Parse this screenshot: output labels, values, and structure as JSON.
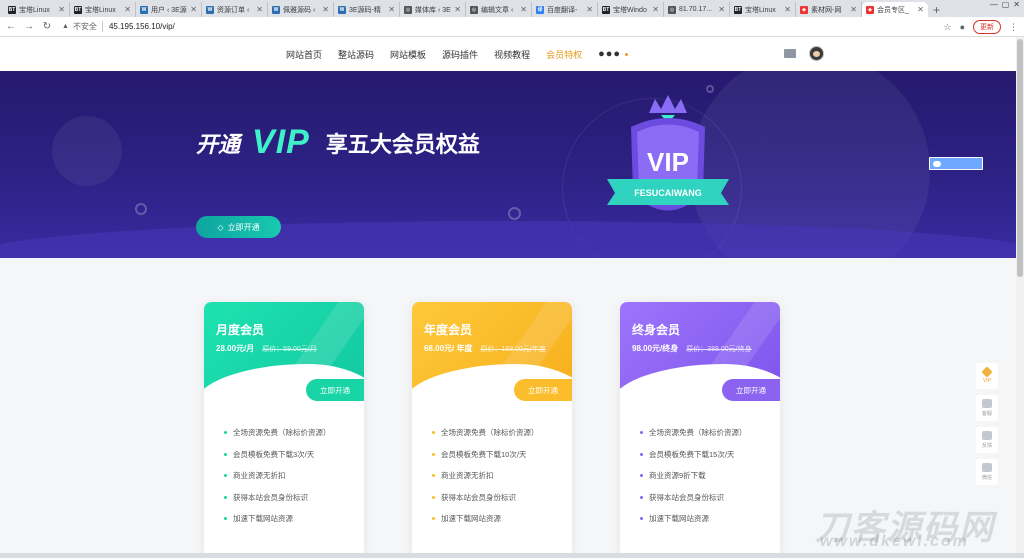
{
  "browser": {
    "tabs": [
      {
        "label": "宝塔Linux",
        "fav": "BT",
        "color": "#20232a"
      },
      {
        "label": "宝塔Linux",
        "fav": "BT",
        "color": "#20232a"
      },
      {
        "label": "用户 ‹ 3E源",
        "fav": "W",
        "color": "#2a6fb0"
      },
      {
        "label": "资源订单 ‹",
        "fav": "W",
        "color": "#2a6fb0"
      },
      {
        "label": "佩雅源码 ‹",
        "fav": "W",
        "color": "#2a6fb0"
      },
      {
        "label": "3E源码-精",
        "fav": "W",
        "color": "#2a6fb0"
      },
      {
        "label": "媒体库 ‹ 3E",
        "fav": "◎",
        "color": "#555"
      },
      {
        "label": "编辑文章 ‹",
        "fav": "◎",
        "color": "#555"
      },
      {
        "label": "百度翻译-",
        "fav": "译",
        "color": "#2f7ff0"
      },
      {
        "label": "宝塔Windo",
        "fav": "BT",
        "color": "#20232a"
      },
      {
        "label": "81.70.17...",
        "fav": "◎",
        "color": "#555"
      },
      {
        "label": "宝塔Linux",
        "fav": "BT",
        "color": "#20232a"
      },
      {
        "label": "素材网-网",
        "fav": "◆",
        "color": "#e33"
      },
      {
        "label": "会员专区_",
        "fav": "◆",
        "color": "#e33"
      }
    ],
    "new_tab": "+",
    "insecure_label": "不安全",
    "url": "45.195.156.10/vip/",
    "update_label": "更新"
  },
  "nav": {
    "items": [
      "网站首页",
      "整站源码",
      "网站模板",
      "源码插件",
      "视频教程"
    ],
    "vip_item": "会员特权",
    "more": "●●●"
  },
  "hero": {
    "open": "开通",
    "vip": "VIP",
    "tagline": "享五大会员权益",
    "button": "立即开通",
    "badge_vip": "VIP",
    "badge_text": "FESUCAIWANG"
  },
  "plans": [
    {
      "name": "月度会员",
      "price": "28.00元/月",
      "original": "原价：59.00元/月",
      "button": "立即开通",
      "color": "#19d4a5",
      "features": [
        "全场资源免费（除标价资源）",
        "会员模板免费下载3次/天",
        "商业资源无折扣",
        "获得本站会员身份标识",
        "加速下载网站资源"
      ]
    },
    {
      "name": "年度会员",
      "price": "68.00元/ 年度",
      "original": "原价：168.00元/年度",
      "button": "立即开通",
      "color": "#fbbd2b",
      "features": [
        "全场资源免费（除标价资源）",
        "会员模板免费下载10次/天",
        "商业资源无折扣",
        "获得本站会员身份标识",
        "加速下载网站资源"
      ]
    },
    {
      "name": "终身会员",
      "price": "98.00元/终身",
      "original": "原价：388.00元/终身",
      "button": "立即开通",
      "color": "#8b63f0",
      "features": [
        "全场资源免费（除标价资源）",
        "会员模板免费下载15次/天",
        "商业资源9折下载",
        "获得本站会员身份标识",
        "加速下载网站资源"
      ]
    }
  ],
  "side_float": [
    "VIP",
    "客服",
    "反馈",
    "微信"
  ],
  "watermark": {
    "line1": "刀客源码网",
    "line2": "www.dkewl.com"
  }
}
